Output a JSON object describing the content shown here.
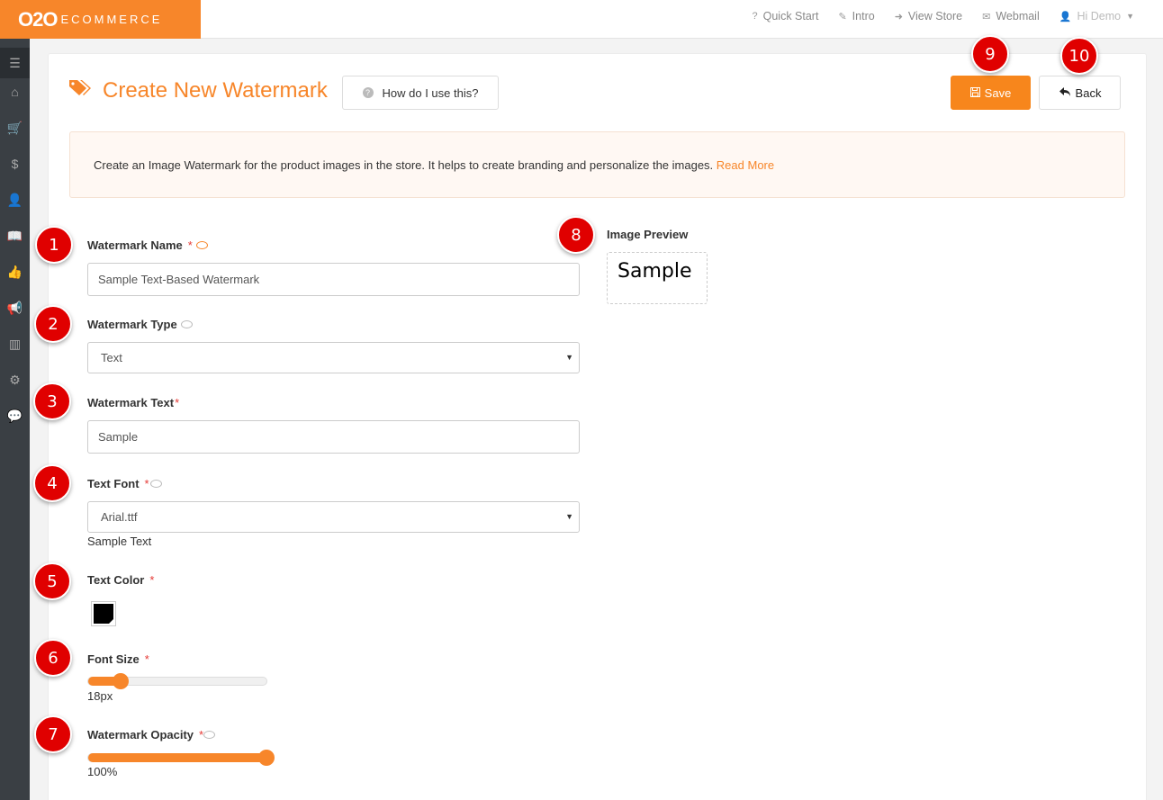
{
  "brand": {
    "logo_bold": "O2O",
    "logo_rest": "ECOMMERCE",
    "color": "#f7862a"
  },
  "topnav": [
    {
      "icon": "question-icon",
      "glyph": "?",
      "label": "Quick Start"
    },
    {
      "icon": "wand-icon",
      "glyph": "✎",
      "label": "Intro"
    },
    {
      "icon": "sign-in-icon",
      "glyph": "➜",
      "label": "View Store"
    },
    {
      "icon": "envelope-icon",
      "glyph": "✉",
      "label": "Webmail"
    },
    {
      "icon": "user-icon",
      "glyph": "👤",
      "label": "Hi Demo"
    }
  ],
  "sidebar": [
    {
      "icon": "menu-icon",
      "glyph": "☰"
    },
    {
      "icon": "home-icon",
      "glyph": "⌂"
    },
    {
      "icon": "cart-icon",
      "glyph": "🛒"
    },
    {
      "icon": "dollar-icon",
      "glyph": "$"
    },
    {
      "icon": "user-icon",
      "glyph": "👤"
    },
    {
      "icon": "book-icon",
      "glyph": "📖"
    },
    {
      "icon": "thumbs-up-icon",
      "glyph": "👍"
    },
    {
      "icon": "bullhorn-icon",
      "glyph": "📢"
    },
    {
      "icon": "bar-chart-icon",
      "glyph": "▥"
    },
    {
      "icon": "cogs-icon",
      "glyph": "⚙"
    },
    {
      "icon": "comment-icon",
      "glyph": "💬"
    }
  ],
  "header": {
    "title": "Create New Watermark",
    "help_button": "How do I use this?",
    "save_button": "Save",
    "back_button": "Back"
  },
  "info": {
    "text": "Create an Image Watermark for the product images in the store. It helps to create branding and personalize the images.",
    "link": "Read More"
  },
  "form": {
    "name_label": "Watermark Name",
    "name_value": "Sample Text-Based Watermark",
    "type_label": "Watermark Type",
    "type_value": "Text",
    "text_label": "Watermark Text",
    "text_value": "Sample",
    "font_label": "Text Font",
    "font_value": "Arial.ttf",
    "font_sample": "Sample Text",
    "color_label": "Text Color",
    "color_value": "#000000",
    "size_label": "Font Size",
    "size_value": "18px",
    "size_fraction": 0.18,
    "opacity_label": "Watermark Opacity",
    "opacity_value": "100%",
    "opacity_fraction": 1.0,
    "required": "*"
  },
  "preview": {
    "label": "Image Preview",
    "text": "Sample"
  },
  "markers": [
    "1",
    "2",
    "3",
    "4",
    "5",
    "6",
    "7",
    "8",
    "9",
    "10"
  ]
}
